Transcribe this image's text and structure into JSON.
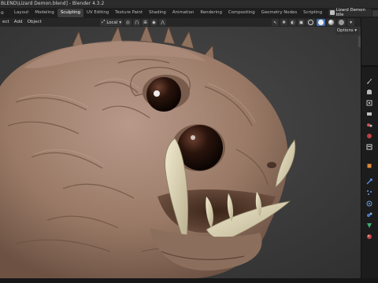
{
  "window": {
    "title": "BLEND\\Lizard Demon.blend] - Blender 4.3.2",
    "app_menu_label": "o"
  },
  "workspaces": {
    "tabs": [
      "Layout",
      "Modeling",
      "Sculpting",
      "UV Editing",
      "Texture Paint",
      "Shading",
      "Animation",
      "Rendering",
      "Compositing",
      "Geometry Nodes",
      "Scripting"
    ],
    "active": "Sculpting",
    "add_label": "+",
    "scene_name": "Lizard Demon Idle"
  },
  "viewport_header": {
    "menus": [
      "ect",
      "Add",
      "Object"
    ],
    "orientation": "Local",
    "options_label": "Options"
  },
  "colors": {
    "accent": "#4772b3",
    "creature_skin": "#9a7a66",
    "fang": "#d8d0b0",
    "eye": "#1a0c08"
  },
  "properties_tabs": [
    "tool",
    "render",
    "output",
    "view-layer",
    "scene",
    "world",
    "collection",
    "object",
    "modifiers",
    "particles",
    "physics",
    "constraints",
    "data",
    "material",
    "texture"
  ]
}
